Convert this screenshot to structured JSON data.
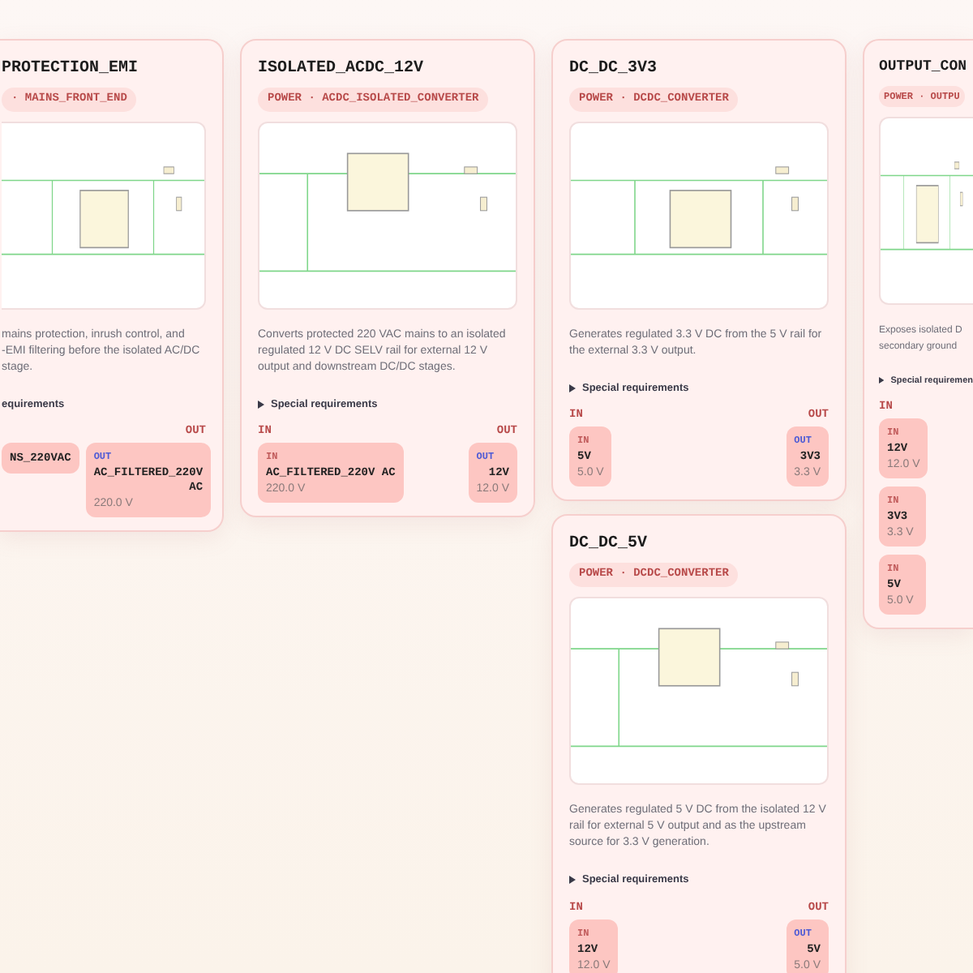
{
  "cards": [
    {
      "kind": "clipped-left",
      "title": "PROTECTION_EMI",
      "badge": "· MAINS_FRONT_END",
      "description": [
        "mains protection, inrush control, and",
        "-EMI filtering before the isolated AC/DC",
        "stage."
      ],
      "requirements": "equirements",
      "out_header": "OUT",
      "inputs": [
        {
          "name": "NS_220VAC"
        }
      ],
      "outputs": [
        {
          "label": "OUT",
          "name": "AC_FILTERED_220V AC",
          "value": "220.0 V"
        }
      ]
    },
    {
      "kind": "full",
      "title": "ISOLATED_ACDC_12V",
      "badge": "POWER · ACDC_ISOLATED_CONVERTER",
      "description": [
        "Converts protected 220 VAC mains to an isolated",
        "regulated 12 V DC SELV rail for external 12 V",
        "output and downstream DC/DC stages."
      ],
      "requirements": "Special requirements",
      "in_header": "IN",
      "out_header": "OUT",
      "inputs": [
        {
          "label": "IN",
          "name": "AC_FILTERED_220V AC",
          "value": "220.0 V"
        }
      ],
      "outputs": [
        {
          "label": "OUT",
          "name": "12V",
          "value": "12.0 V"
        }
      ]
    },
    {
      "kind": "full",
      "title": "DC_DC_3V3",
      "badge": "POWER · DCDC_CONVERTER",
      "description": [
        "Generates regulated 3.3 V DC from the 5 V rail for",
        "the external 3.3 V output."
      ],
      "requirements": "Special requirements",
      "in_header": "IN",
      "out_header": "OUT",
      "inputs": [
        {
          "label": "IN",
          "name": "5V",
          "value": "5.0 V"
        }
      ],
      "outputs": [
        {
          "label": "OUT",
          "name": "3V3",
          "value": "3.3 V"
        }
      ]
    },
    {
      "kind": "full",
      "title": "DC_DC_5V",
      "badge": "POWER · DCDC_CONVERTER",
      "description": [
        "Generates regulated 5 V DC from the isolated 12 V",
        "rail for external 5 V output and as the upstream",
        "source for 3.3 V generation."
      ],
      "requirements": "Special requirements",
      "in_header": "IN",
      "out_header": "OUT",
      "inputs": [
        {
          "label": "IN",
          "name": "12V",
          "value": "12.0 V"
        }
      ],
      "outputs": [
        {
          "label": "OUT",
          "name": "5V",
          "value": "5.0 V"
        }
      ]
    },
    {
      "kind": "clipped-right",
      "title": "OUTPUT_CON",
      "badge": "POWER · OUTPU",
      "description": [
        "Exposes isolated D",
        "secondary ground"
      ],
      "requirements": "Special requiremen",
      "in_header": "IN",
      "inputs": [
        {
          "label": "IN",
          "name": "12V",
          "value": "12.0 V"
        },
        {
          "label": "IN",
          "name": "3V3",
          "value": "3.3 V"
        },
        {
          "label": "IN",
          "name": "5V",
          "value": "5.0 V"
        }
      ]
    }
  ]
}
